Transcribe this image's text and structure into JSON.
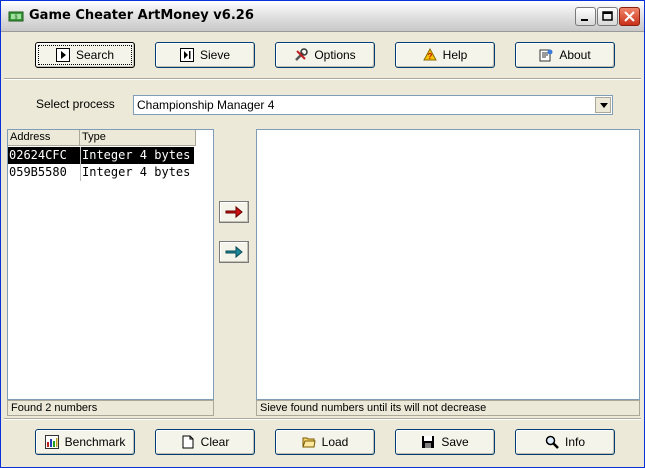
{
  "window": {
    "title": "Game Cheater ArtMoney v6.26"
  },
  "toolbar_top": {
    "search_label": "Search",
    "sieve_label": "Sieve",
    "options_label": "Options",
    "help_label": "Help",
    "about_label": "About"
  },
  "process": {
    "label": "Select process",
    "selected": "Championship Manager 4"
  },
  "results": {
    "columns": [
      "Address",
      "Type"
    ],
    "rows": [
      {
        "address": "02624CFC",
        "type": "Integer 4 bytes"
      },
      {
        "address": "059B5580",
        "type": "Integer 4 bytes"
      }
    ],
    "status": "Found 2 numbers"
  },
  "table": {
    "status": "Sieve found numbers until its will not decrease"
  },
  "toolbar_bottom": {
    "benchmark_label": "Benchmark",
    "clear_label": "Clear",
    "load_label": "Load",
    "save_label": "Save",
    "info_label": "Info"
  },
  "colors": {
    "move_one": "#d01010",
    "move_all": "#1a8a9a"
  }
}
